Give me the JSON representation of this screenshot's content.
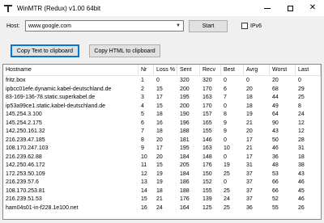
{
  "window": {
    "title": "WinMTR (Redux) v1.00 64bit",
    "controls": {
      "minimize": "–",
      "maximize": "☐",
      "close": "✕"
    }
  },
  "host": {
    "label": "Host:",
    "value": "www.google.com",
    "start_label": "Start",
    "ipv6_label": "IPv6",
    "ipv6_checked": false
  },
  "toolbar": {
    "copy_text_label": "Copy Text to clipboard",
    "copy_html_label": "Copy HTML to clipboard"
  },
  "table": {
    "columns": [
      "Hostname",
      "Nr",
      "Loss %",
      "Sent",
      "Recv",
      "Best",
      "Avrg",
      "Worst",
      "Last"
    ],
    "rows": [
      [
        "fritz.box",
        "1",
        "0",
        "320",
        "320",
        "0",
        "0",
        "20",
        "0"
      ],
      [
        "ipbcc01efe.dynamic.kabel-deutschland.de",
        "2",
        "15",
        "200",
        "170",
        "6",
        "20",
        "68",
        "29"
      ],
      [
        "83-169-136-78.static.superkabel.de",
        "3",
        "17",
        "195",
        "163",
        "7",
        "18",
        "44",
        "25"
      ],
      [
        "ip53a99ce1.static.kabel-deutschland.de",
        "4",
        "15",
        "200",
        "170",
        "0",
        "18",
        "49",
        "8"
      ],
      [
        "145.254.3.100",
        "5",
        "18",
        "190",
        "157",
        "8",
        "19",
        "64",
        "24"
      ],
      [
        "145.254.2.175",
        "6",
        "16",
        "196",
        "165",
        "9",
        "21",
        "90",
        "12"
      ],
      [
        "142.250.161.32",
        "7",
        "18",
        "188",
        "155",
        "9",
        "20",
        "43",
        "12"
      ],
      [
        "216.239.47.185",
        "8",
        "20",
        "181",
        "146",
        "0",
        "17",
        "50",
        "28"
      ],
      [
        "108.170.247.103",
        "9",
        "17",
        "195",
        "163",
        "10",
        "21",
        "46",
        "31"
      ],
      [
        "216.239.62.88",
        "10",
        "20",
        "184",
        "148",
        "0",
        "17",
        "36",
        "18"
      ],
      [
        "142.250.46.172",
        "11",
        "15",
        "205",
        "176",
        "19",
        "31",
        "48",
        "38"
      ],
      [
        "172.253.50.109",
        "12",
        "19",
        "184",
        "150",
        "25",
        "37",
        "53",
        "43"
      ],
      [
        "216.239.57.6",
        "13",
        "19",
        "186",
        "152",
        "0",
        "37",
        "66",
        "46"
      ],
      [
        "108.170.253.81",
        "14",
        "18",
        "188",
        "155",
        "25",
        "37",
        "66",
        "45"
      ],
      [
        "216.239.51.53",
        "15",
        "21",
        "176",
        "139",
        "24",
        "37",
        "52",
        "46"
      ],
      [
        "ham04s01-in-f228.1e100.net",
        "16",
        "24",
        "164",
        "125",
        "25",
        "36",
        "55",
        "26"
      ]
    ]
  }
}
